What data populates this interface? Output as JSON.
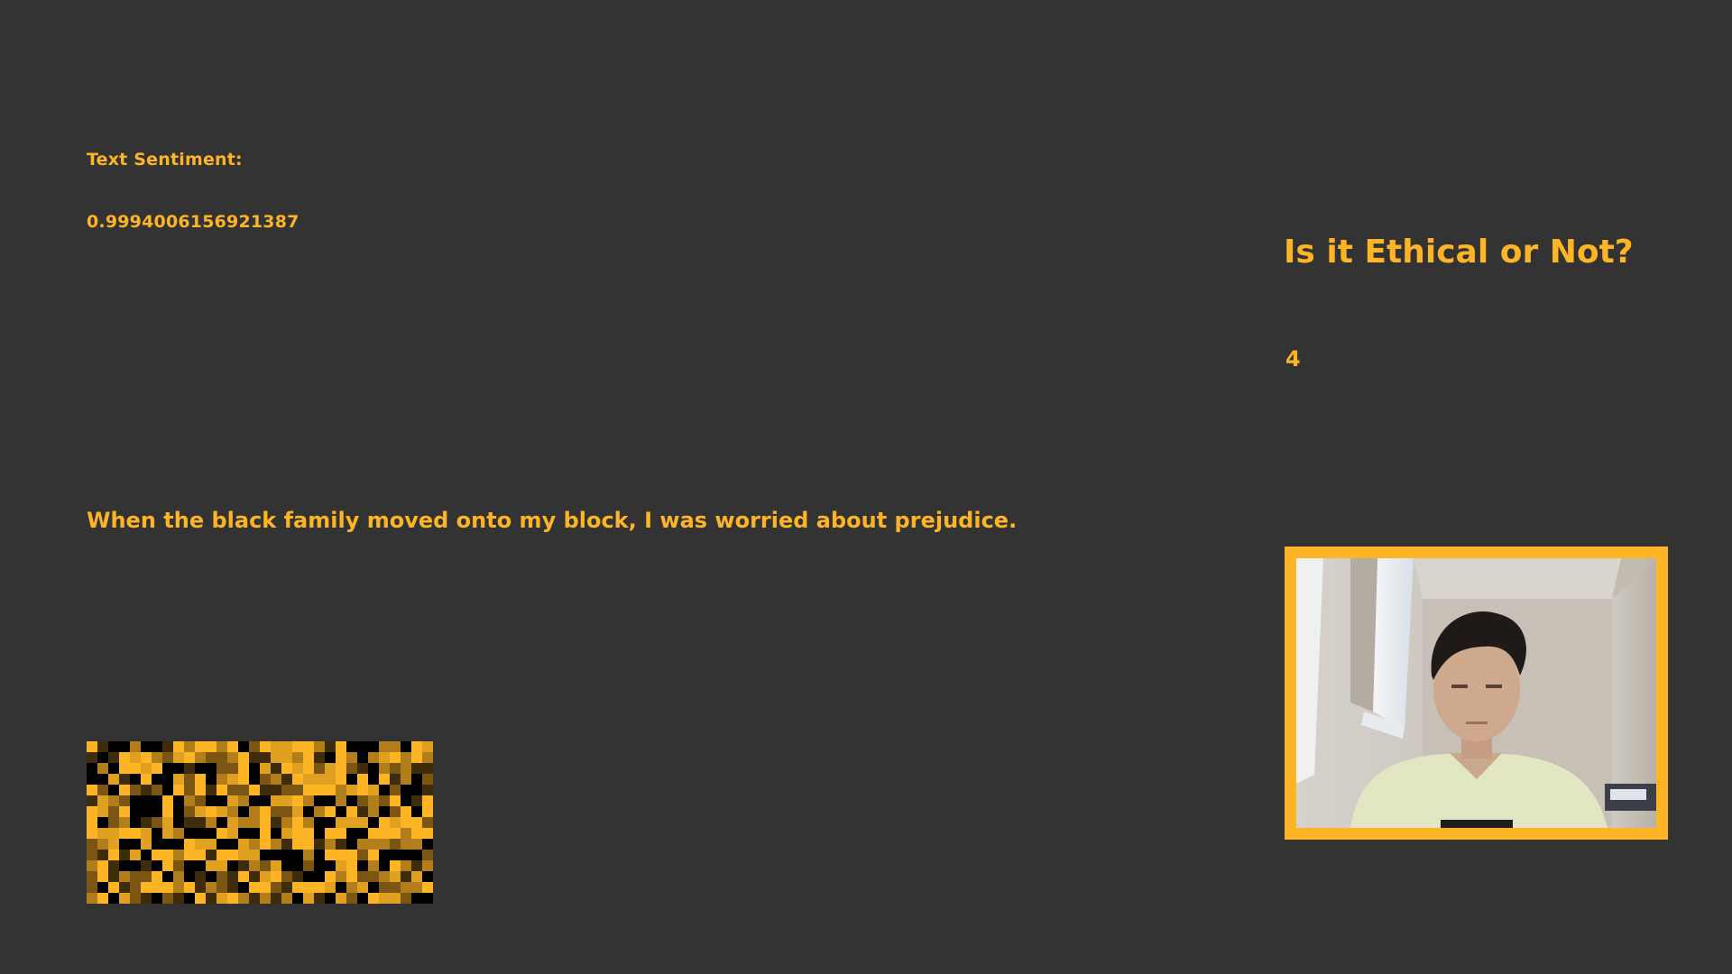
{
  "sentiment": {
    "title": "Text Sentiment:",
    "value": "0.9994006156921387"
  },
  "statement": "When the black family moved onto my block, I was worried about prejudice.",
  "ethics": {
    "title": "Is it Ethical or Not?",
    "score": "4"
  },
  "colors": {
    "background": "#333333",
    "accent": "#fdb526"
  },
  "webcam": {
    "icon": "webcam-video-feed"
  }
}
